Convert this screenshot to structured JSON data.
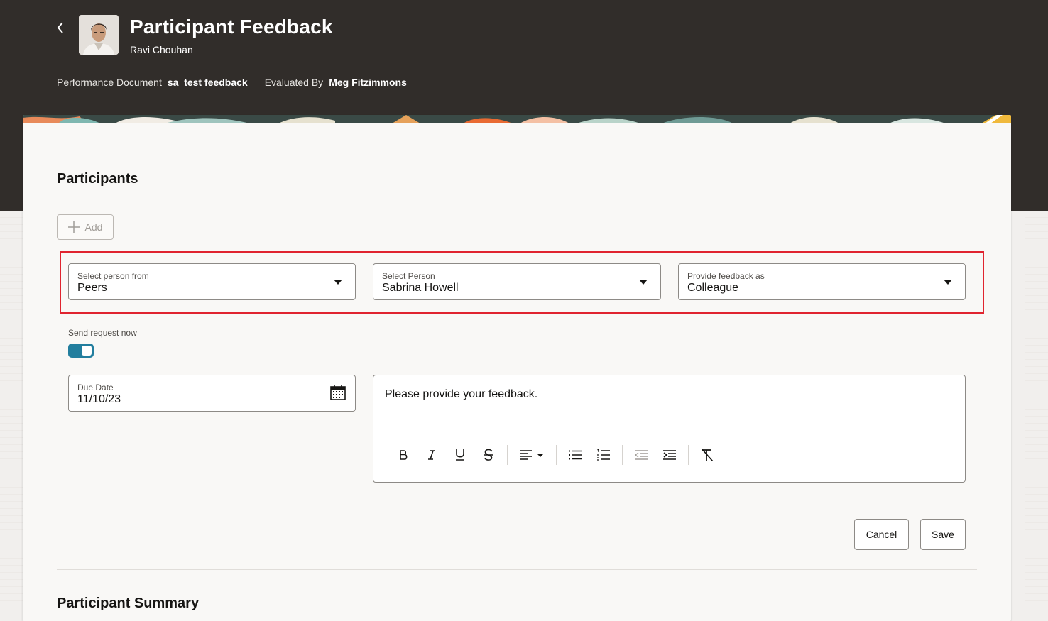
{
  "header": {
    "title": "Participant Feedback",
    "subtitle": "Ravi Chouhan",
    "meta": [
      {
        "label": "Performance Document",
        "value": "sa_test feedback"
      },
      {
        "label": "Evaluated By",
        "value": "Meg Fitzimmons"
      }
    ],
    "back_icon": "chevron-left-icon",
    "avatar_icon": "user-photo"
  },
  "participants": {
    "title": "Participants",
    "add_label": "Add",
    "fields": {
      "select_from": {
        "label": "Select person from",
        "value": "Peers"
      },
      "select_person": {
        "label": "Select Person",
        "value": "Sabrina Howell"
      },
      "feedback_as": {
        "label": "Provide feedback as",
        "value": "Colleague"
      }
    },
    "send_request": {
      "label": "Send request now",
      "on": true
    },
    "due_date": {
      "label": "Due Date",
      "value": "11/10/23"
    },
    "editor": {
      "text": "Please provide your feedback."
    },
    "cancel_label": "Cancel",
    "save_label": "Save"
  },
  "summary": {
    "title": "Participant Summary"
  },
  "colors": {
    "header_bg": "#312d2a",
    "highlight": "#e0242f",
    "toggle_on": "#227e9e"
  }
}
